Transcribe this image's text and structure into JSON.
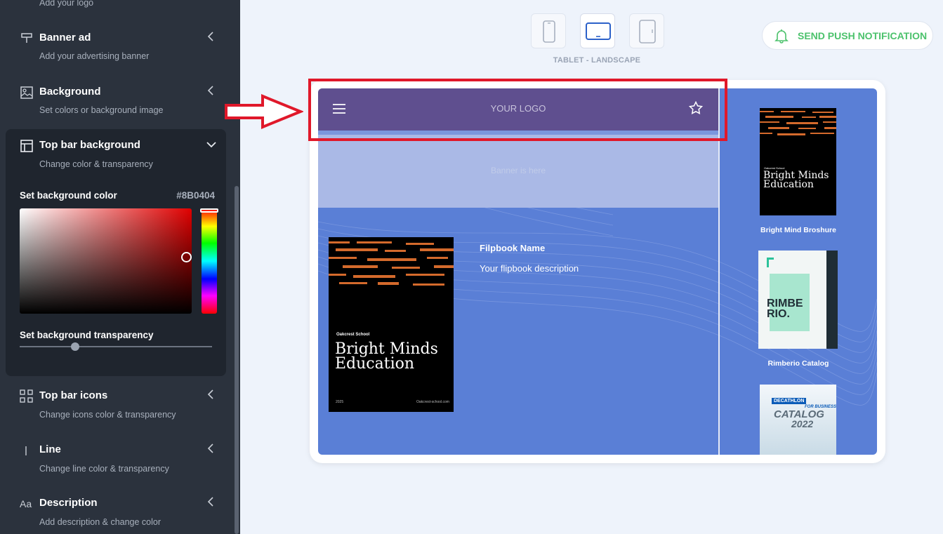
{
  "sidebar": {
    "logo_sub": "Add your logo",
    "items": [
      {
        "title": "Banner ad",
        "sub": "Add your advertising banner",
        "icon": "banner-icon"
      },
      {
        "title": "Background",
        "sub": "Set colors or background image",
        "icon": "image-icon"
      },
      {
        "title": "Top bar background",
        "sub": "Change color & transparency",
        "icon": "layout-icon"
      },
      {
        "title": "Top bar icons",
        "sub": "Change icons color & transparency",
        "icon": "grid-icon"
      },
      {
        "title": "Line",
        "sub": "Change line color & transparency",
        "icon": "line-icon"
      },
      {
        "title": "Description",
        "sub": "Add description & change color",
        "icon": "text-icon"
      }
    ],
    "color_picker": {
      "label": "Set background color",
      "hex": "#8B0404",
      "transparency_label": "Set background transparency",
      "transparency_value": 0.27
    }
  },
  "toolbar": {
    "devices": [
      "phone-portrait",
      "tablet-landscape",
      "tablet-portrait"
    ],
    "active_device_label": "TABLET - LANDSCAPE",
    "push_label": "SEND PUSH NOTIFICATION"
  },
  "preview": {
    "logo_text": "YOUR LOGO",
    "banner_text": "Banner is here",
    "flipbook_name": "Filpbook Name",
    "flipbook_description": "Your flipbook description",
    "main_book": {
      "school": "Oakcrest School",
      "title_line1": "Bright Minds",
      "title_line2": "Education",
      "year": "2025",
      "site": "Oakcrest-school.com"
    },
    "thumbnails": [
      {
        "caption": "Bright Mind Broshure",
        "title_line1": "Bright Minds",
        "title_line2": "Education",
        "school": "Oakcrest School"
      },
      {
        "caption": "Rimberio Catalog",
        "title_line1": "RIMBE",
        "title_line2": "RIO."
      },
      {
        "caption": "",
        "brand": "DECATHLON",
        "brand_sub": "FOR BUSINESS",
        "title": "CATALOG",
        "year": "2022"
      }
    ]
  },
  "colors": {
    "sidebar_bg": "#2b323d",
    "topbar_bg": "#5f4f8f",
    "preview_bg": "#5a7fd6",
    "accent_green": "#4cc26c",
    "annotation_red": "#e0182a"
  }
}
